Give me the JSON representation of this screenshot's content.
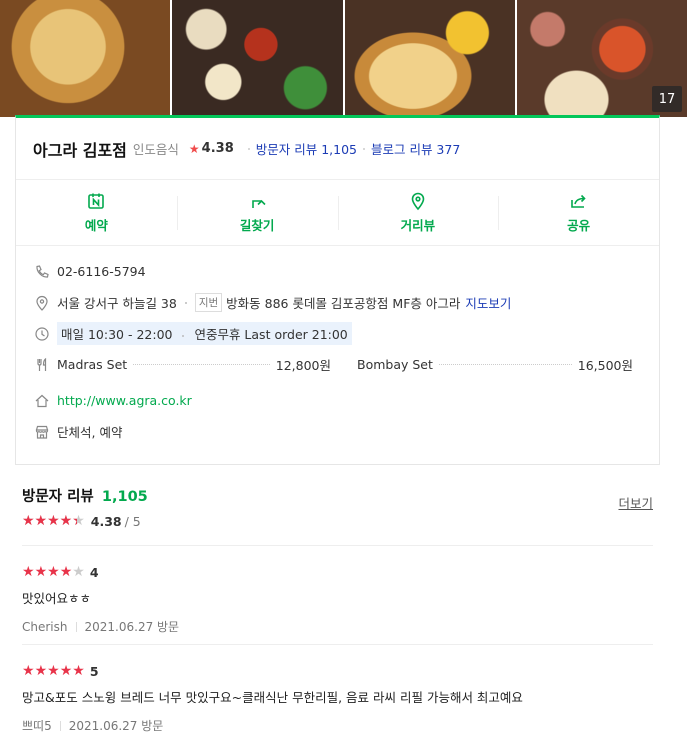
{
  "photos": {
    "count": "17"
  },
  "place": {
    "name": "아그라 김포점",
    "category": "인도음식",
    "rating": "4.38",
    "visitor_reviews_label": "방문자 리뷰 1,105",
    "blog_reviews_label": "블로그 리뷰 377"
  },
  "actions": [
    {
      "label": "예약",
      "icon": "reservation-icon"
    },
    {
      "label": "길찾기",
      "icon": "directions-icon"
    },
    {
      "label": "거리뷰",
      "icon": "streetview-icon"
    },
    {
      "label": "공유",
      "icon": "share-icon"
    }
  ],
  "info": {
    "phone": "02-6116-5794",
    "address": "서울 강서구 하늘길 38",
    "lot_tag": "지번",
    "lot_address": "방화동 886 롯데몰 김포공항점 MF층 아그라",
    "map_link": "지도보기",
    "hours": "매일 10:30 - 22:00",
    "hours_note": "연중무휴 Last order 21:00",
    "menu": [
      {
        "name": "Madras Set",
        "price": "12,800원"
      },
      {
        "name": "Bombay Set",
        "price": "16,500원"
      }
    ],
    "website": "http://www.agra.co.kr",
    "facilities": "단체석, 예약"
  },
  "reviews_section": {
    "title": "방문자 리뷰",
    "count": "1,105",
    "more_label": "더보기",
    "average": "4.38",
    "max": "/ 5",
    "average_stars_fraction": 0.876
  },
  "reviews": [
    {
      "score": "4",
      "stars": 4,
      "text": "맛있어요ㅎㅎ",
      "author": "Cherish",
      "date": "2021.06.27 방문"
    },
    {
      "score": "5",
      "stars": 5,
      "text": "망고&포도 스노윙 브레드 너무 맛있구요~클래식난 무한리필, 음료 라씨 리필 가능해서 최고예요",
      "author": "쁘띠5",
      "date": "2021.06.27 방문"
    }
  ],
  "colors": {
    "accent_green": "#03c75a",
    "link_blue": "#1c3cb5",
    "star_red": "#e8344a"
  }
}
